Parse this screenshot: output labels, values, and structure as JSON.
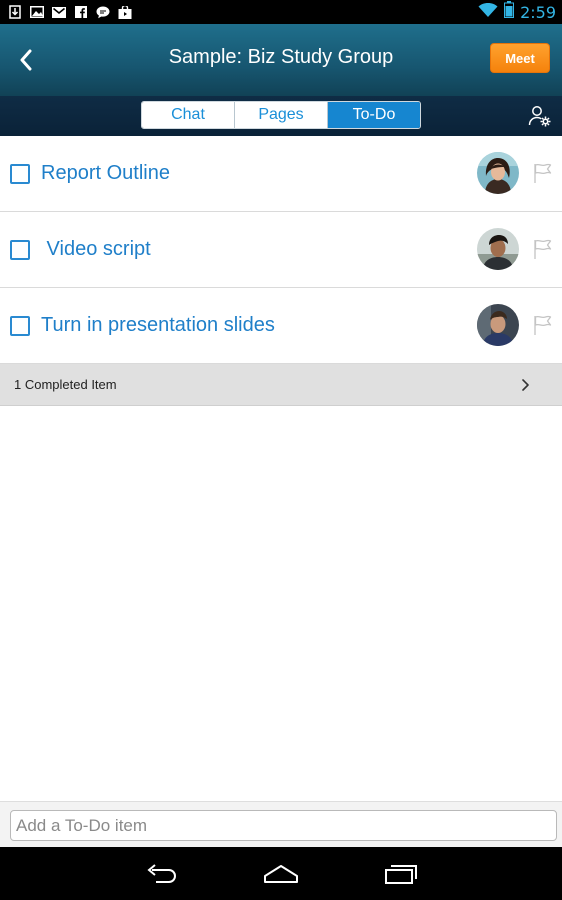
{
  "status_bar": {
    "time": "2:59",
    "icons": [
      "download-icon",
      "image-icon",
      "gmail-icon",
      "facebook-icon",
      "chat-bubble-icon",
      "store-icon",
      "wifi-icon",
      "battery-icon"
    ]
  },
  "header": {
    "title": "Sample: Biz Study Group",
    "meet_label": "Meet"
  },
  "tabs": [
    {
      "label": "Chat",
      "active": false
    },
    {
      "label": "Pages",
      "active": false
    },
    {
      "label": "To-Do",
      "active": true
    }
  ],
  "todos": [
    {
      "label": "Report Outline",
      "avatar": "avatar-woman-icon"
    },
    {
      "label": " Video script",
      "avatar": "avatar-man-icon"
    },
    {
      "label": "Turn in presentation slides",
      "avatar": "avatar-man-2-icon"
    }
  ],
  "completed": {
    "label": "1 Completed Item"
  },
  "input": {
    "placeholder": "Add a To-Do item"
  },
  "colors": {
    "accent": "#1f7fc9",
    "meet": "#f5820c",
    "clock": "#33b5e5"
  }
}
